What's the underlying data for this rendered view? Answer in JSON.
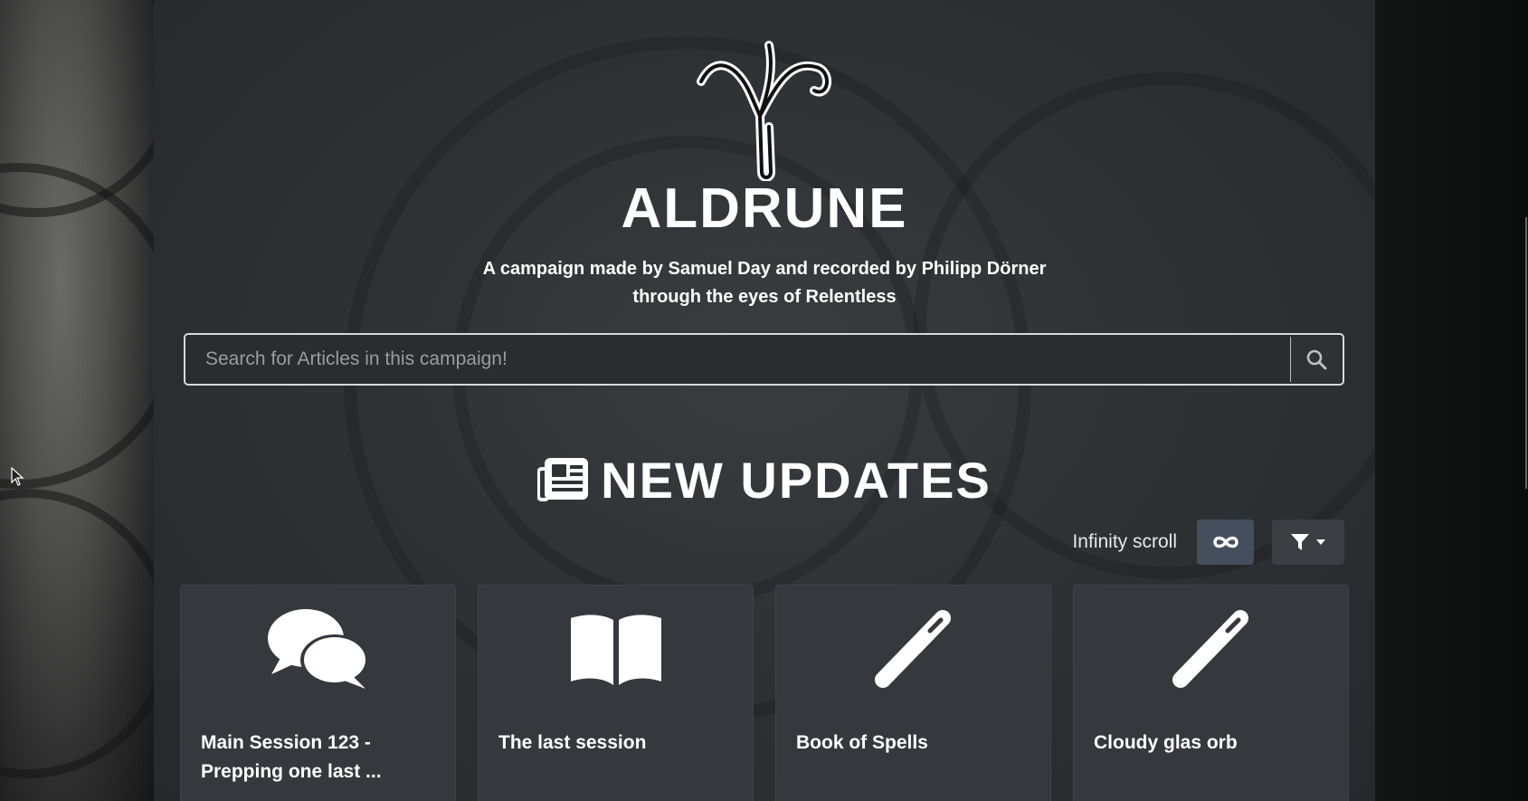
{
  "brand": {
    "title": "ALDRUNE",
    "subtitle": "A campaign made by Samuel Day and recorded by Philipp Dörner through the eyes of Relentless",
    "logo_icon": "algiz-rune-logo"
  },
  "search": {
    "placeholder": "Search for Articles in this campaign!",
    "value": "",
    "button_icon": "search-icon"
  },
  "updates": {
    "section_icon": "newspaper-icon",
    "title": "NEW UPDATES",
    "infinity_label": "Infinity scroll",
    "infinity_icon": "infinity-icon",
    "filter_icon": "filter-icon"
  },
  "cards": [
    {
      "icon": "comments-icon",
      "title": "Main Session 123 - Prepping one last ..."
    },
    {
      "icon": "open-book-icon",
      "title": "The last session"
    },
    {
      "icon": "magic-wand-icon",
      "title": "Book of Spells"
    },
    {
      "icon": "magic-wand-icon",
      "title": "Cloudy glas orb"
    }
  ],
  "colors": {
    "background": "#2f3235",
    "card": "#35383c",
    "infinity_button": "#454e5c",
    "text": "#ffffff"
  }
}
